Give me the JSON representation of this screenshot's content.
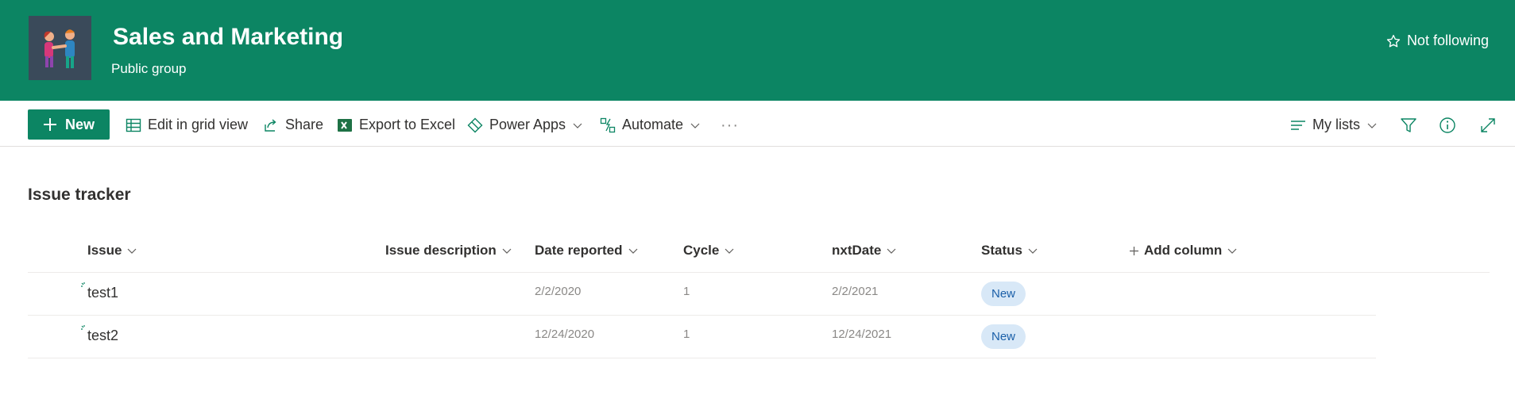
{
  "header": {
    "site_title": "Sales and Marketing",
    "site_subtitle": "Public group",
    "follow_label": "Not following",
    "theme_color": "#0c8563"
  },
  "toolbar": {
    "new_label": "New",
    "edit_grid_label": "Edit in grid view",
    "share_label": "Share",
    "export_label": "Export to Excel",
    "powerapps_label": "Power Apps",
    "automate_label": "Automate",
    "more_label": "···",
    "views_label": "My lists"
  },
  "list": {
    "title": "Issue tracker",
    "columns": [
      "Issue",
      "Issue description",
      "Date reported",
      "Cycle",
      "nxtDate",
      "Status",
      "Add column"
    ],
    "rows": [
      {
        "issue": "test1",
        "description": "",
        "date_reported": "2/2/2020",
        "cycle": "1",
        "nxt_date": "2/2/2021",
        "status": "New"
      },
      {
        "issue": "test2",
        "description": "",
        "date_reported": "12/24/2020",
        "cycle": "1",
        "nxt_date": "12/24/2021",
        "status": "New"
      }
    ]
  }
}
